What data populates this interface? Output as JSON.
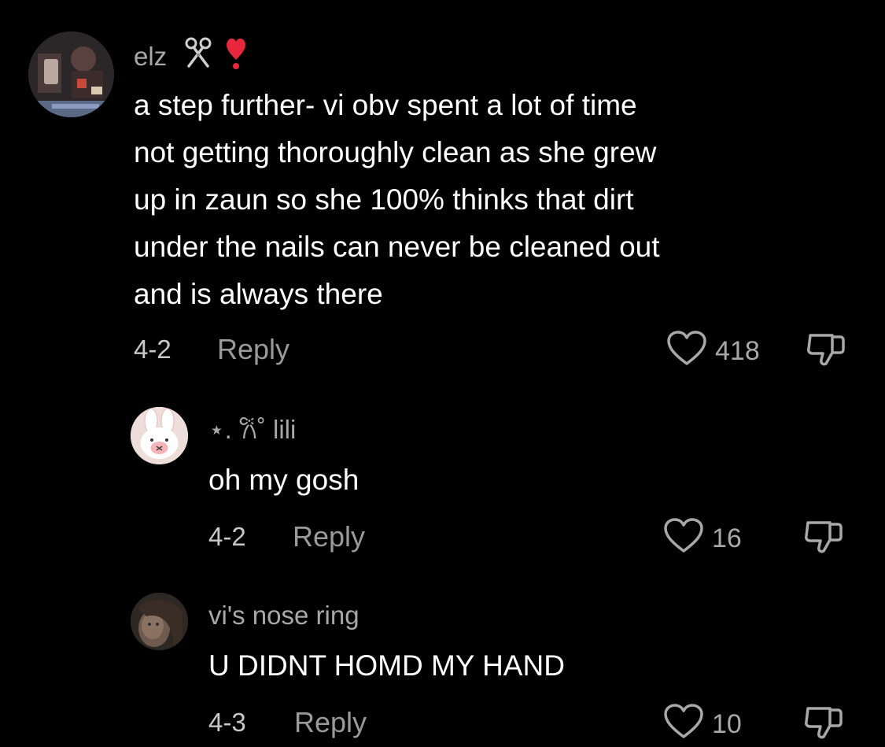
{
  "comments": [
    {
      "username": "elz",
      "username_icons": [
        "scissors-icon",
        "red-exclamation-icon"
      ],
      "text": "a step further- vi obv spent a lot of time\nnot getting thoroughly clean as she grew\nup in zaun so she 100% thinks that dirt\nunder the nails can never be cleaned out\nand is always there",
      "date": "4-2",
      "reply_label": "Reply",
      "likes": "418"
    },
    {
      "username": "⋆. 𐙚˚ lili",
      "text": "oh my gosh",
      "date": "4-2",
      "reply_label": "Reply",
      "likes": "16"
    },
    {
      "username": "vi's nose ring",
      "text": "U DIDNT HOMD MY HAND",
      "date": "4-3",
      "reply_label": "Reply",
      "likes": "10"
    }
  ],
  "colors": {
    "background": "#000000",
    "text": "#ffffff",
    "muted": "#a8a8a8",
    "accent_red": "#e8263c"
  }
}
